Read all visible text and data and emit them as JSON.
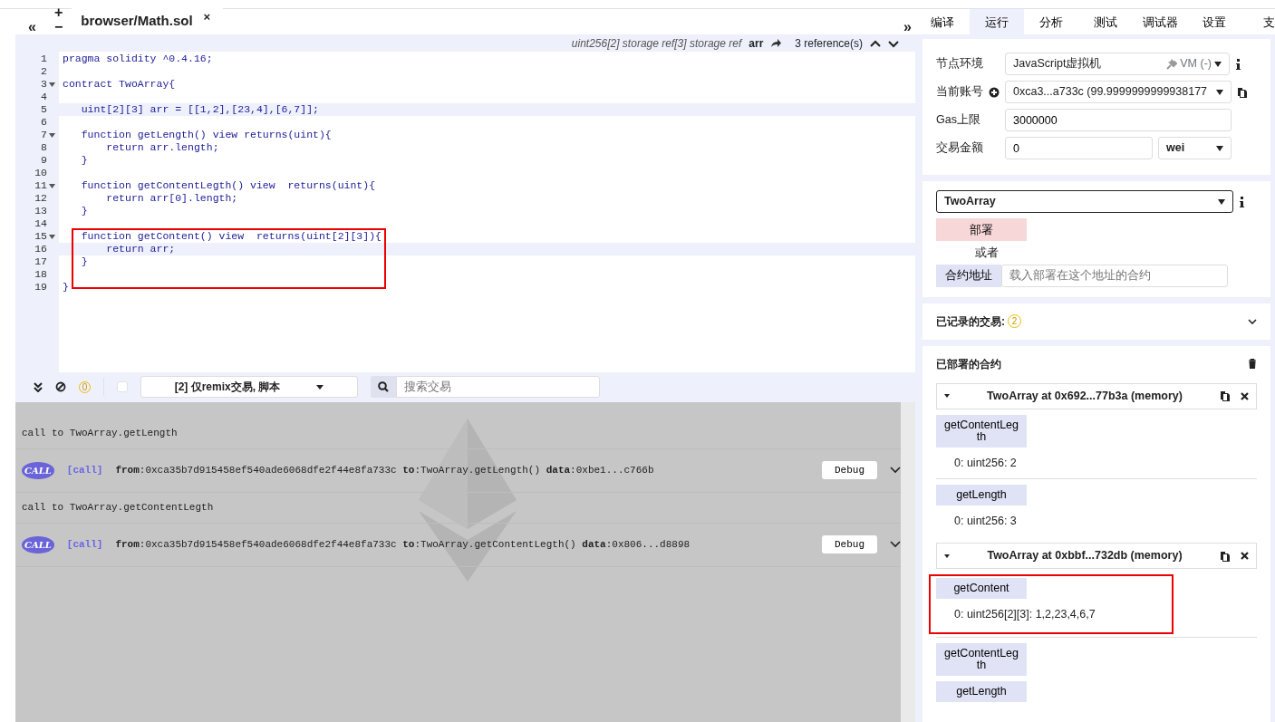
{
  "editor": {
    "collapse_left": "«",
    "add_file": "+",
    "remove_file": "−",
    "expand_right": "»",
    "tabs": [
      {
        "label": "browser/Math.sol",
        "selected": true,
        "close": "×"
      }
    ],
    "info": {
      "type": "uint256[2] storage ref[3] storage ref",
      "name": "arr",
      "references": "3 reference(s)"
    },
    "lines": [
      {
        "number": "1",
        "foldable": false,
        "highlighted": false,
        "boxed": false,
        "code": "pragma solidity ^0.4.16;"
      },
      {
        "number": "2",
        "foldable": false,
        "highlighted": false,
        "boxed": false
      },
      {
        "number": "3",
        "foldable": true,
        "highlighted": false,
        "boxed": false,
        "code": "contract TwoArray{"
      },
      {
        "number": "4",
        "foldable": false,
        "highlighted": false,
        "boxed": false
      },
      {
        "number": "5",
        "foldable": false,
        "highlighted": true,
        "boxed": false,
        "code": "   uint[2][3] arr = [[1,2],[23,4],[6,7]];"
      },
      {
        "number": "6",
        "foldable": false,
        "highlighted": false,
        "boxed": false
      },
      {
        "number": "7",
        "foldable": true,
        "highlighted": false,
        "boxed": false,
        "code": "   function getLength() view returns(uint){"
      },
      {
        "number": "8",
        "foldable": false,
        "highlighted": false,
        "boxed": false,
        "code": "       return arr.length;"
      },
      {
        "number": "9",
        "foldable": false,
        "highlighted": false,
        "boxed": false,
        "code": "   }"
      },
      {
        "number": "10",
        "foldable": false,
        "highlighted": false,
        "boxed": false
      },
      {
        "number": "11",
        "foldable": true,
        "highlighted": false,
        "boxed": false,
        "code": "   function getContentLegth() view  returns(uint){"
      },
      {
        "number": "12",
        "foldable": false,
        "highlighted": false,
        "boxed": false,
        "code": "       return arr[0].length;"
      },
      {
        "number": "13",
        "foldable": false,
        "highlighted": false,
        "boxed": false,
        "code": "   }"
      },
      {
        "number": "14",
        "foldable": false,
        "highlighted": false,
        "boxed": false
      },
      {
        "number": "15",
        "foldable": true,
        "highlighted": false,
        "boxed": true,
        "code": "   function getContent() view  returns(uint[2][3]){"
      },
      {
        "number": "16",
        "foldable": false,
        "highlighted": true,
        "boxed": true,
        "code": "       return arr;"
      },
      {
        "number": "17",
        "foldable": false,
        "highlighted": false,
        "boxed": true,
        "code": "   }"
      },
      {
        "number": "18",
        "foldable": false,
        "highlighted": false,
        "boxed": true
      },
      {
        "number": "19",
        "foldable": false,
        "highlighted": false,
        "boxed": false,
        "code": "}"
      }
    ]
  },
  "terminal": {
    "pending_count": "0",
    "filter_checked": false,
    "filter": "[2] 仅remix交易, 脚本",
    "search_placeholder": "搜索交易",
    "entries": [
      {
        "kind": "note",
        "text": "call to TwoArray.getLength"
      },
      {
        "kind": "tx",
        "badge": "CALL",
        "type": "[call]",
        "details": "**from**:0xca35b7d915458ef540ade6068dfe2f44e8fa733c **to**:TwoArray.getLength() **data**:0xbe1...c766b",
        "button": "Debug"
      },
      {
        "kind": "note",
        "text": "call to TwoArray.getContentLegth"
      },
      {
        "kind": "tx",
        "badge": "CALL",
        "type": "[call]",
        "details": "**from**:0xca35b7d915458ef540ade6068dfe2f44e8fa733c **to**:TwoArray.getContentLegth() **data**:0x806...d8898",
        "button": "Debug"
      }
    ]
  },
  "panel": {
    "tabs": [
      {
        "label": "编译",
        "selected": false
      },
      {
        "label": "运行",
        "selected": true
      },
      {
        "label": "分析",
        "selected": false
      },
      {
        "label": "测试",
        "selected": false
      },
      {
        "label": "调试器",
        "selected": false
      },
      {
        "label": "设置",
        "selected": false
      },
      {
        "label": "支",
        "selected": false
      }
    ],
    "environment": {
      "label": "节点环境",
      "value": "JavaScript虚拟机",
      "vm": "VM (-)"
    },
    "account": {
      "label": "当前账号",
      "value": "0xca3...a733c (99.9999999999938177"
    },
    "gas_limit": {
      "label": "Gas上限",
      "value": "3000000"
    },
    "value": {
      "label": "交易金额",
      "value": "0",
      "unit": "wei"
    },
    "contract": "TwoArray",
    "deploy": "部署",
    "or": "或者",
    "at_address": "合约地址",
    "address_placeholder": "载入部署在这个地址的合约",
    "recorded": {
      "label": "已记录的交易:",
      "count": "2"
    },
    "deployed": {
      "title": "已部署的合约",
      "instances": [
        {
          "title": "TwoArray at 0x692...77b3a (memory)",
          "functions": [
            {
              "name": "getContentLegth",
              "result": "0: uint256: 2",
              "boxed": false
            },
            {
              "name": "getLength",
              "result": "0: uint256: 3",
              "boxed": false
            }
          ]
        },
        {
          "title": "TwoArray at 0xbbf...732db (memory)",
          "functions": [
            {
              "name": "getContent",
              "result": "0: uint256[2][3]: 1,2,23,4,6,7",
              "boxed": true
            },
            {
              "name": "getContentLegth",
              "boxed": false
            },
            {
              "name": "getLength",
              "boxed": false
            }
          ]
        }
      ]
    }
  }
}
